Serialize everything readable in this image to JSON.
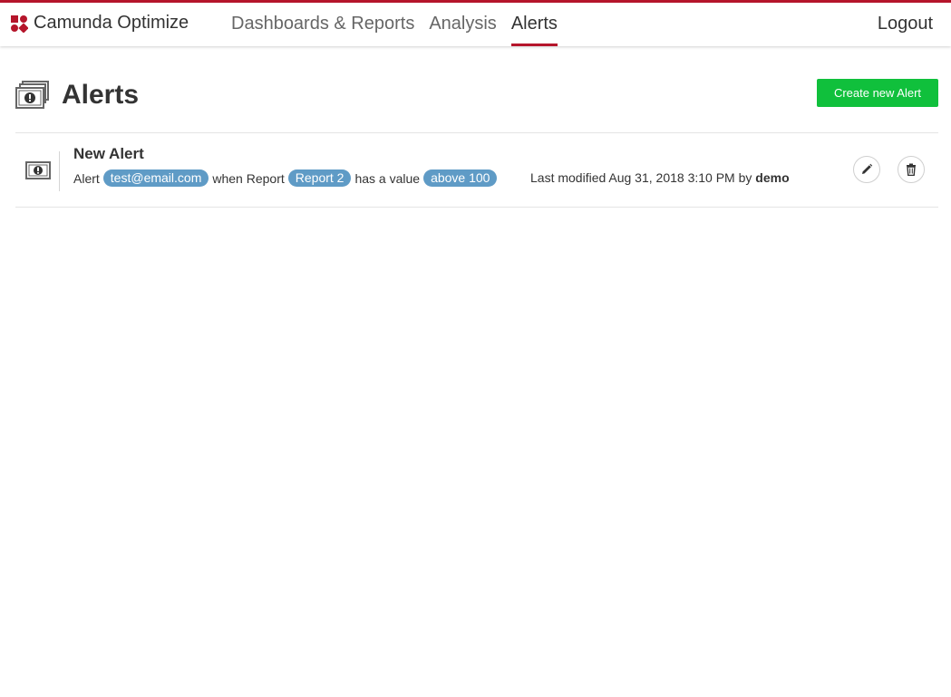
{
  "header": {
    "brand_name": "Camunda Optimize",
    "nav": [
      {
        "label": "Dashboards & Reports",
        "active": false
      },
      {
        "label": "Analysis",
        "active": false
      },
      {
        "label": "Alerts",
        "active": true
      }
    ],
    "logout_label": "Logout",
    "accent_color": "#b5152b"
  },
  "page": {
    "title": "Alerts",
    "icon": "alerts-icon",
    "create_button_label": "Create new Alert",
    "create_button_color": "#10c03c"
  },
  "alerts": [
    {
      "name": "New Alert",
      "icon": "alert-icon",
      "text_alert": "Alert",
      "email": "test@email.com",
      "text_when_report": "when Report",
      "report": "Report 2",
      "text_has_value": "has a value",
      "condition": "above 100",
      "modified_prefix": "Last modified Aug 31, 2018 3:10 PM by",
      "modified_by": "demo",
      "edit_icon": "pencil-icon",
      "delete_icon": "trash-icon"
    }
  ],
  "tag_color": "#5f9bc6"
}
